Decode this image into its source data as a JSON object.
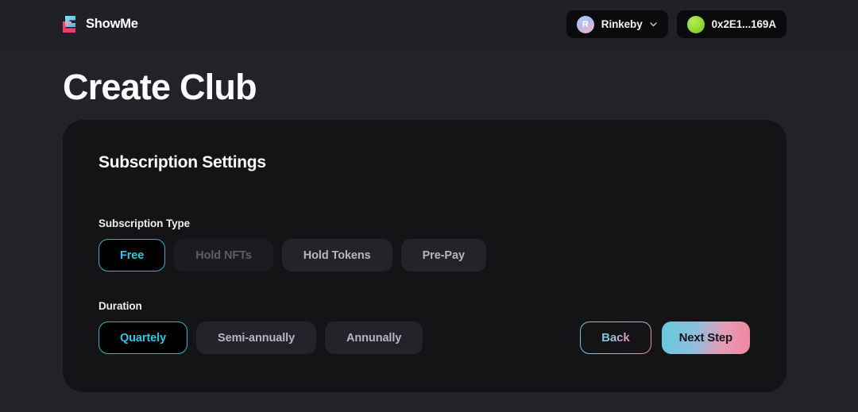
{
  "topbar": {
    "brand_name": "ShowMe",
    "brand_icon": "showme-s-logo",
    "network": {
      "label": "Rinkeby",
      "avatar_letter": "R",
      "chevron_icon": "chevron-down-icon"
    },
    "wallet": {
      "address": "0x2E1...169A",
      "status_dot_color": "#8fd631"
    }
  },
  "page": {
    "title": "Create Club"
  },
  "card": {
    "title": "Subscription Settings",
    "subscription_type": {
      "label": "Subscription Type",
      "options": [
        {
          "label": "Free",
          "state": "selected"
        },
        {
          "label": "Hold NFTs",
          "state": "disabled"
        },
        {
          "label": "Hold Tokens",
          "state": "default"
        },
        {
          "label": "Pre-Pay",
          "state": "default"
        }
      ]
    },
    "duration": {
      "label": "Duration",
      "options": [
        {
          "label": "Quartely",
          "state": "selected"
        },
        {
          "label": "Semi-annually",
          "state": "default"
        },
        {
          "label": "Annunally",
          "state": "default"
        }
      ]
    },
    "nav": {
      "back_label": "Back",
      "next_label": "Next Step"
    }
  },
  "theme": {
    "page_bg": "#222228",
    "topbar_bg": "#202026",
    "card_bg": "#141417",
    "accent_cyan": "#2ec8e6",
    "accent_pink": "#f0849f",
    "status_green": "#8fd631"
  }
}
